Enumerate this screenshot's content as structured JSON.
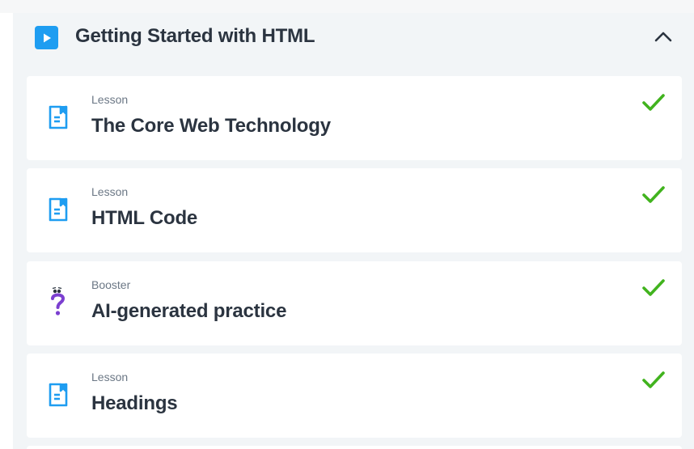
{
  "colors": {
    "accent": "#1e9df1",
    "success": "#41b31e",
    "booster": "#7b3fd0",
    "text_primary": "#2b3440",
    "text_secondary": "#6b7785",
    "section_bg": "#f2f5f7"
  },
  "module": {
    "icon": "play-icon",
    "title": "Getting Started with HTML",
    "collapse_icon": "chevron-up-icon"
  },
  "items": [
    {
      "type": "Lesson",
      "title": "The Core Web Technology",
      "icon": "lesson-document-icon",
      "completed": true
    },
    {
      "type": "Lesson",
      "title": "HTML Code",
      "icon": "lesson-document-icon",
      "completed": true
    },
    {
      "type": "Booster",
      "title": "AI-generated practice",
      "icon": "booster-question-icon",
      "completed": true
    },
    {
      "type": "Lesson",
      "title": "Headings",
      "icon": "lesson-document-icon",
      "completed": true
    }
  ]
}
